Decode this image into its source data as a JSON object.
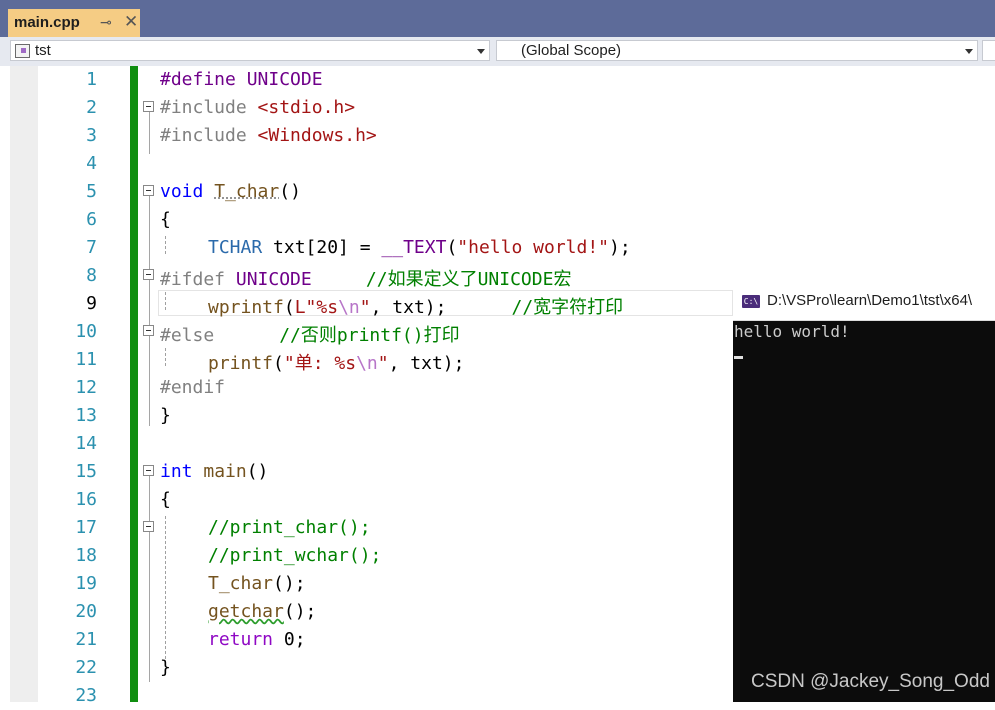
{
  "tab": {
    "title": "main.cpp",
    "pin_icon": "⊸",
    "close_icon": "✕"
  },
  "nav": {
    "project": "tst",
    "scope": "(Global Scope)"
  },
  "lines": [
    {
      "n": "1"
    },
    {
      "n": "2"
    },
    {
      "n": "3"
    },
    {
      "n": "4"
    },
    {
      "n": "5"
    },
    {
      "n": "6"
    },
    {
      "n": "7"
    },
    {
      "n": "8"
    },
    {
      "n": "9"
    },
    {
      "n": "10"
    },
    {
      "n": "11"
    },
    {
      "n": "12"
    },
    {
      "n": "13"
    },
    {
      "n": "14"
    },
    {
      "n": "15"
    },
    {
      "n": "16"
    },
    {
      "n": "17"
    },
    {
      "n": "18"
    },
    {
      "n": "19"
    },
    {
      "n": "20"
    },
    {
      "n": "21"
    },
    {
      "n": "22"
    },
    {
      "n": "23"
    }
  ],
  "code": {
    "l1": [
      "#define ",
      "UNICODE"
    ],
    "l2": [
      "#include ",
      "<stdio.h>"
    ],
    "l3": [
      "#include ",
      "<Windows.h>"
    ],
    "l5": [
      "void",
      " ",
      "T_char",
      "()"
    ],
    "l6": [
      "{"
    ],
    "l7": [
      "TCHAR",
      " txt[20] = ",
      "__TEXT",
      "(",
      "\"hello world!\"",
      ");"
    ],
    "l8": [
      "#ifdef ",
      "UNICODE",
      "     ",
      "//如果定义了UNICODE宏"
    ],
    "l9": [
      "wprintf",
      "(",
      "L\"%s",
      "\\n",
      "\"",
      ", txt);",
      "      ",
      "//宽字符打印"
    ],
    "l10": [
      "#else",
      "      ",
      "//否则printf()打印"
    ],
    "l11": [
      "printf",
      "(",
      "\"单: %s",
      "\\n",
      "\"",
      ", txt);"
    ],
    "l12": [
      "#endif"
    ],
    "l13": [
      "}"
    ],
    "l15": [
      "int",
      " ",
      "main",
      "()"
    ],
    "l16": [
      "{"
    ],
    "l17": [
      "//print_char();"
    ],
    "l18": [
      "//print_wchar();"
    ],
    "l19": [
      "T_char",
      "();"
    ],
    "l20": [
      "getchar",
      "();"
    ],
    "l21": [
      "return",
      " 0;"
    ],
    "l22": [
      "}"
    ]
  },
  "console": {
    "title": "D:\\VSPro\\learn\\Demo1\\tst\\x64\\",
    "icon_label": "C:\\",
    "output": "hello world!"
  },
  "watermark": "CSDN @Jackey_Song_Odd",
  "colors": {
    "keyword": "#0000ff",
    "macro": "#6f008a",
    "string": "#a31515",
    "comment": "#008000",
    "function": "#74531f",
    "changebar": "#108e10"
  }
}
